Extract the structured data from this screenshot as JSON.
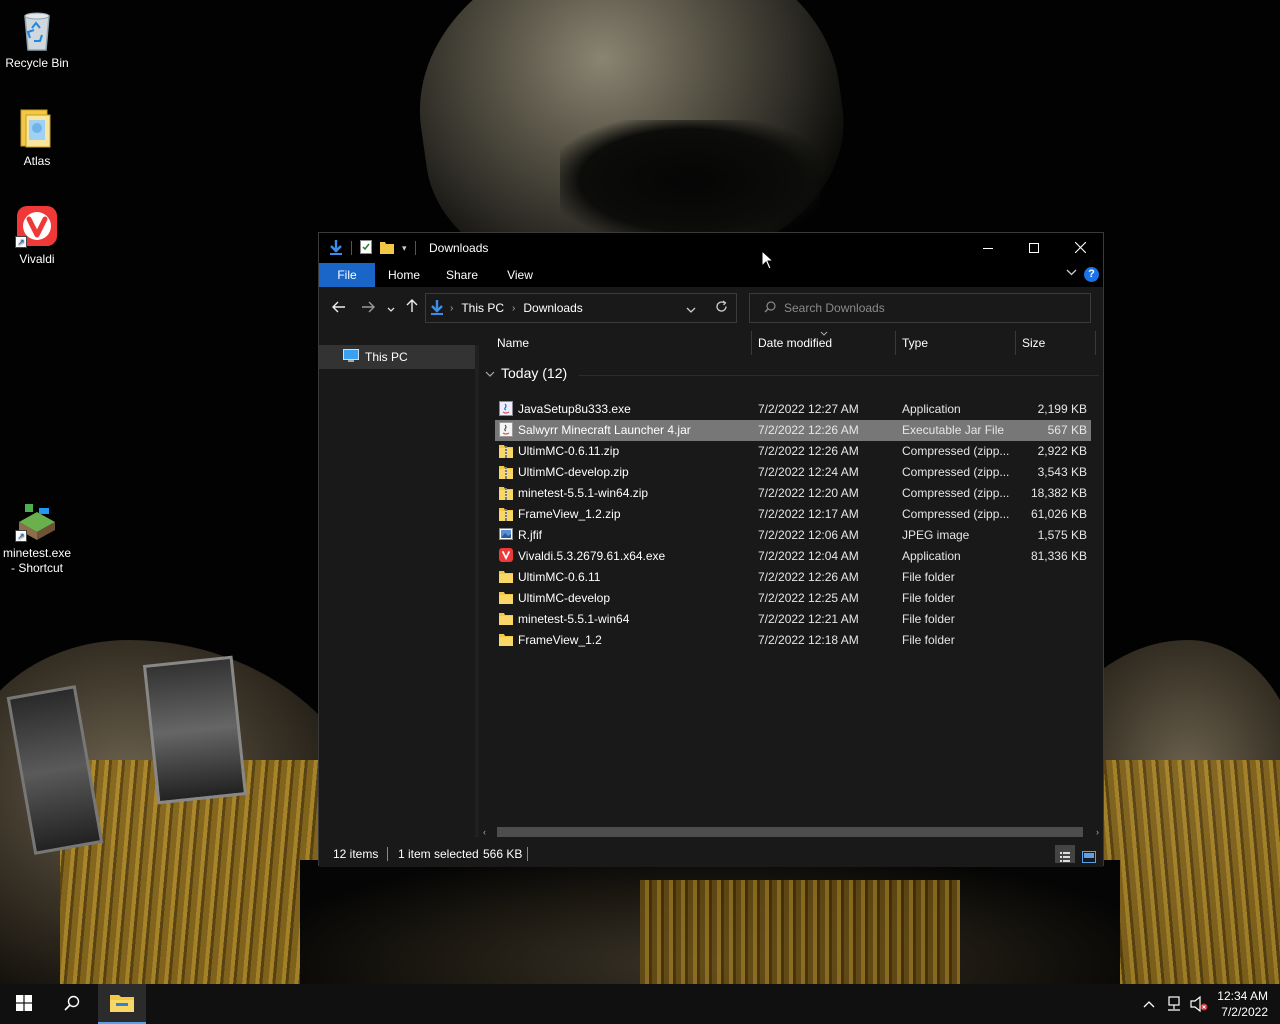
{
  "desktop": {
    "icons": [
      {
        "label": "Recycle Bin",
        "icon": "recycle-bin-icon"
      },
      {
        "label": "Atlas",
        "icon": "folder-icon"
      },
      {
        "label": "Vivaldi",
        "icon": "vivaldi-icon"
      },
      {
        "label_line1": "minetest.exe",
        "label_line2": "- Shortcut",
        "icon": "minetest-icon"
      }
    ]
  },
  "window": {
    "title": "Downloads",
    "controls": {
      "minimize": "—",
      "maximize": "☐",
      "close": "✕"
    }
  },
  "ribbon": {
    "tabs": [
      "File",
      "Home",
      "Share",
      "View"
    ],
    "help": "?"
  },
  "navigation": {
    "breadcrumb": [
      "This PC",
      "Downloads"
    ],
    "search_placeholder": "Search Downloads"
  },
  "tree": {
    "items": [
      {
        "label": "This PC",
        "icon": "pc-icon"
      }
    ]
  },
  "columns": {
    "name": "Name",
    "date": "Date modified",
    "type": "Type",
    "size": "Size"
  },
  "group": {
    "label": "Today (12)"
  },
  "files": [
    {
      "name": "JavaSetup8u333.exe",
      "date": "7/2/2022 12:27 AM",
      "type": "Application",
      "size": "2,199 KB",
      "icon": "java-setup-icon"
    },
    {
      "name": "Salwyrr Minecraft Launcher 4.jar",
      "date": "7/2/2022 12:26 AM",
      "type": "Executable Jar File",
      "size": "567 KB",
      "icon": "jar-icon"
    },
    {
      "name": "UltimMC-0.6.11.zip",
      "date": "7/2/2022 12:26 AM",
      "type": "Compressed (zipp...",
      "size": "2,922 KB",
      "icon": "zip-folder-icon"
    },
    {
      "name": "UltimMC-develop.zip",
      "date": "7/2/2022 12:24 AM",
      "type": "Compressed (zipp...",
      "size": "3,543 KB",
      "icon": "zip-folder-icon"
    },
    {
      "name": "minetest-5.5.1-win64.zip",
      "date": "7/2/2022 12:20 AM",
      "type": "Compressed (zipp...",
      "size": "18,382 KB",
      "icon": "zip-folder-icon"
    },
    {
      "name": "FrameView_1.2.zip",
      "date": "7/2/2022 12:17 AM",
      "type": "Compressed (zipp...",
      "size": "61,026 KB",
      "icon": "zip-folder-icon"
    },
    {
      "name": "R.jfif",
      "date": "7/2/2022 12:06 AM",
      "type": "JPEG image",
      "size": "1,575 KB",
      "icon": "image-icon"
    },
    {
      "name": "Vivaldi.5.3.2679.61.x64.exe",
      "date": "7/2/2022 12:04 AM",
      "type": "Application",
      "size": "81,336 KB",
      "icon": "vivaldi-icon"
    },
    {
      "name": "UltimMC-0.6.11",
      "date": "7/2/2022 12:26 AM",
      "type": "File folder",
      "size": "",
      "icon": "folder-icon"
    },
    {
      "name": "UltimMC-develop",
      "date": "7/2/2022 12:25 AM",
      "type": "File folder",
      "size": "",
      "icon": "folder-icon"
    },
    {
      "name": "minetest-5.5.1-win64",
      "date": "7/2/2022 12:21 AM",
      "type": "File folder",
      "size": "",
      "icon": "folder-icon"
    },
    {
      "name": "FrameView_1.2",
      "date": "7/2/2022 12:18 AM",
      "type": "File folder",
      "size": "",
      "icon": "folder-icon"
    }
  ],
  "selected_index": 1,
  "status": {
    "items": "12 items",
    "selected": "1 item selected",
    "selected_size": "566 KB"
  },
  "taskbar": {
    "time": "12:34 AM",
    "date": "7/2/2022"
  },
  "colors": {
    "accent": "#1a66c8",
    "window_bg": "#191919",
    "selection": "#777777",
    "folder_yellow": "#f3c845"
  }
}
